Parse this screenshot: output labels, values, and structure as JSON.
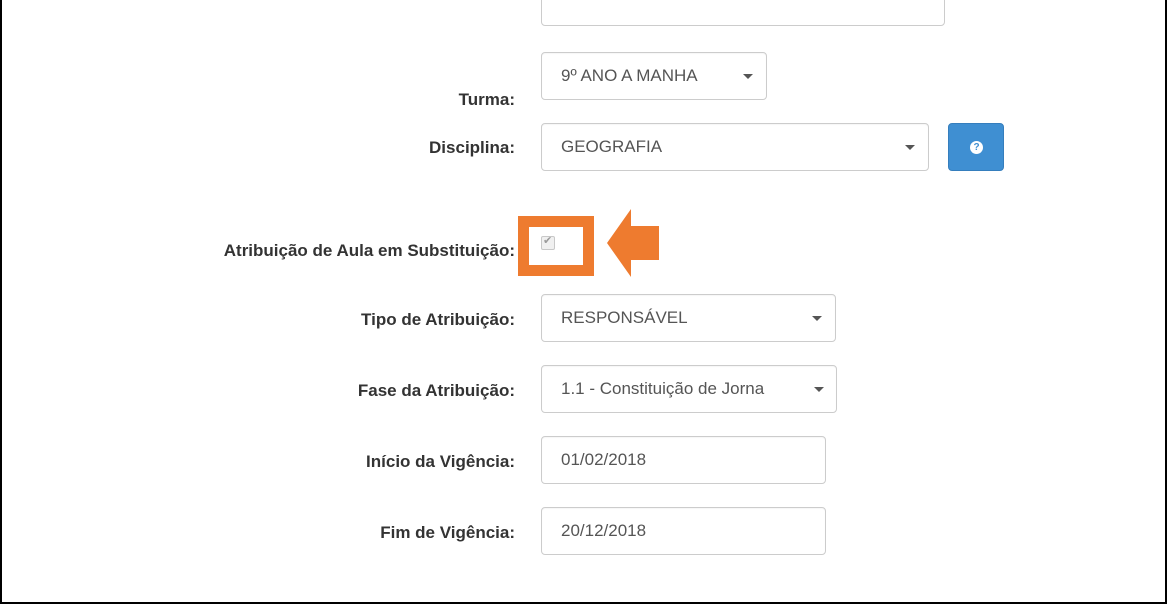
{
  "form": {
    "turma": {
      "label": "Turma:",
      "value": "9º ANO A MANHA"
    },
    "disciplina": {
      "label": "Disciplina:",
      "value": "GEOGRAFIA"
    },
    "help_button": {
      "icon": "question-circle-icon",
      "glyph": "?"
    },
    "substituicao": {
      "label": "Atribuição de Aula em Substituição:",
      "checked": true,
      "disabled": true,
      "tick": "✔"
    },
    "tipo_atribuicao": {
      "label": "Tipo de Atribuição:",
      "value": "RESPONSÁVEL"
    },
    "fase_atribuicao": {
      "label": "Fase da Atribuição:",
      "value": "1.1 - Constituição de Jorna"
    },
    "inicio_vigencia": {
      "label": "Início da Vigência:",
      "value": "01/02/2018"
    },
    "fim_vigencia": {
      "label": "Fim de Vigência:",
      "value": "20/12/2018"
    }
  },
  "annotation": {
    "color": "#ee7b2f",
    "target": "substituicao-checkbox"
  },
  "colors": {
    "primary_button": "#3f8fd2",
    "label_text": "#333333",
    "input_text": "#555555",
    "input_border": "#cccccc"
  }
}
